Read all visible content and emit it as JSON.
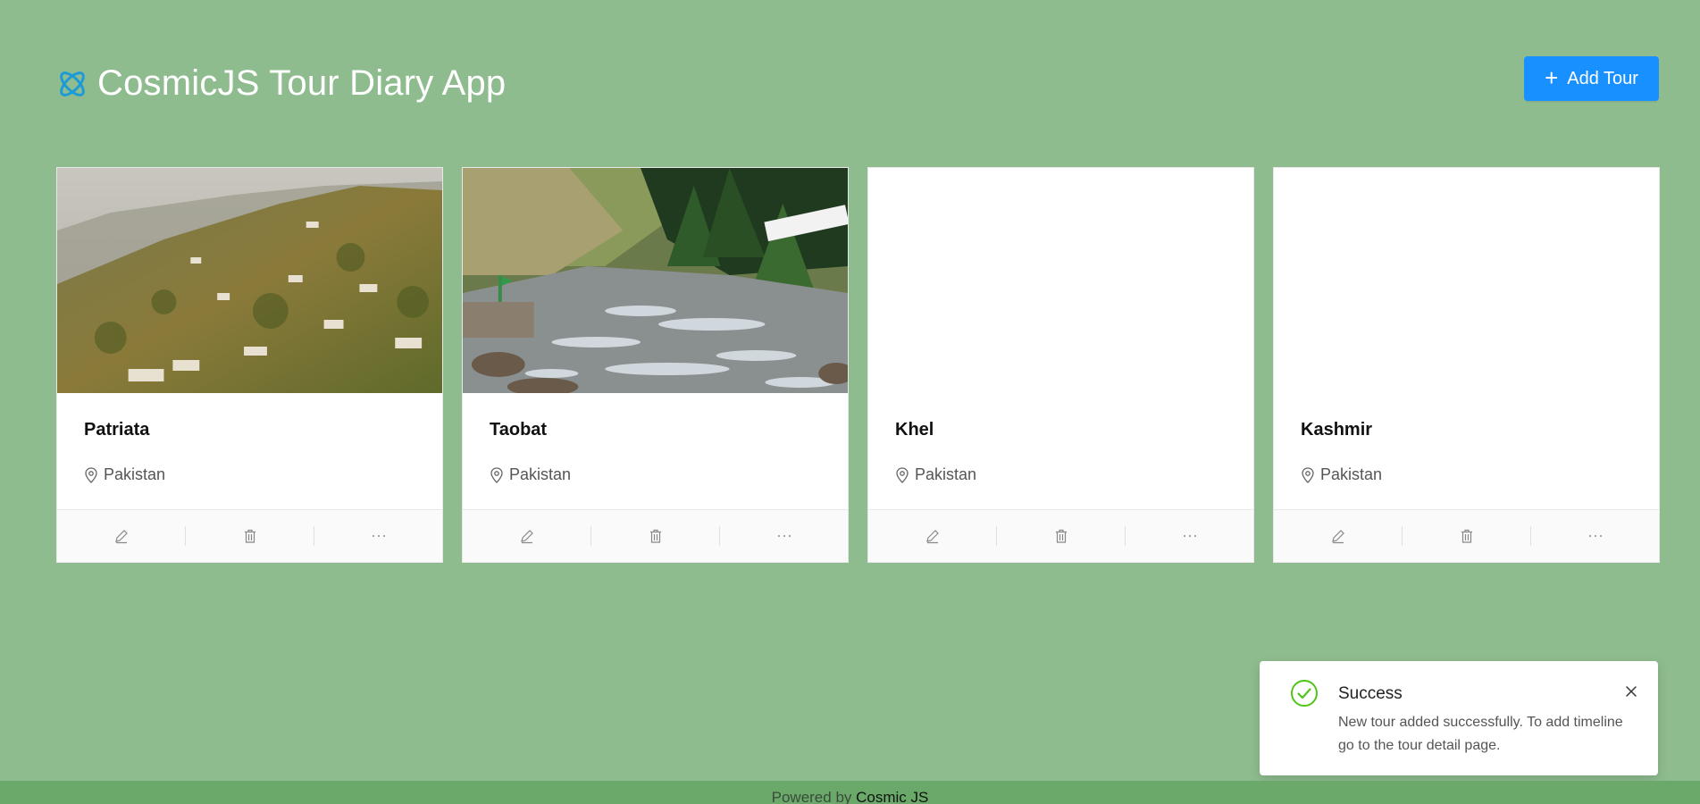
{
  "header": {
    "title": "CosmicJS Tour Diary App",
    "logo_icon": "cosmicjs-logo-icon",
    "add_button_label": "Add Tour",
    "add_button_icon": "plus-icon",
    "accent_color": "#1890ff",
    "background_color": "#8fbc8f"
  },
  "tours": [
    {
      "name": "Patriata",
      "location": "Pakistan",
      "has_image": true
    },
    {
      "name": "Taobat",
      "location": "Pakistan",
      "has_image": true
    },
    {
      "name": "Khel",
      "location": "Pakistan",
      "has_image": false
    },
    {
      "name": "Kashmir",
      "location": "Pakistan",
      "has_image": false
    }
  ],
  "card_actions": [
    "edit-icon",
    "delete-icon",
    "ellipsis-icon"
  ],
  "notification": {
    "title": "Success",
    "message": "New tour added successfully. To add timeline go to the tour detail page.",
    "icon": "check-circle-icon",
    "success_color": "#52c41a"
  },
  "footer": {
    "prefix": "Powered by",
    "link_text": "Cosmic JS"
  }
}
